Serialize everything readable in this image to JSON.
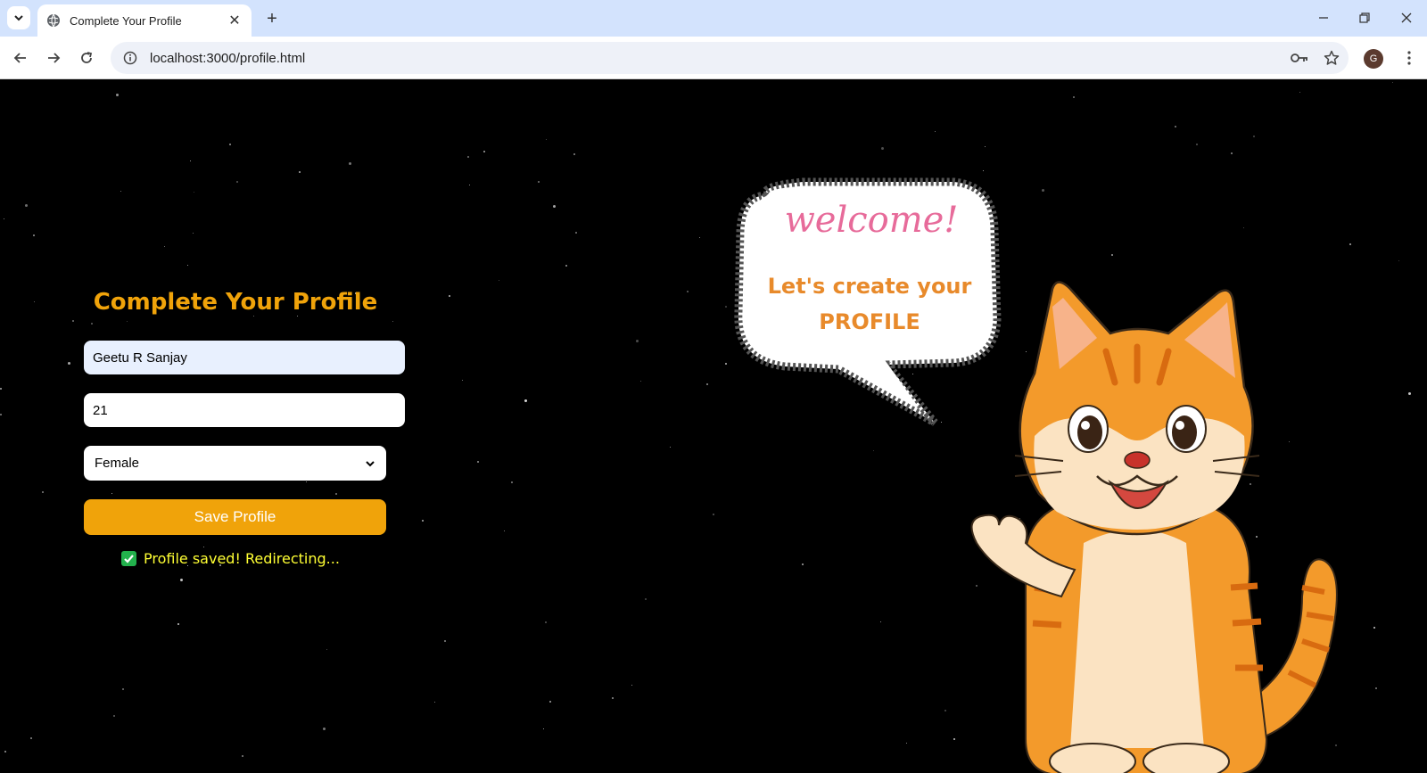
{
  "browser": {
    "tab_title": "Complete Your Profile",
    "url": "localhost:3000/profile.html",
    "profile_initial": "G"
  },
  "form": {
    "title": "Complete Your Profile",
    "name_value": "Geetu R Sanjay",
    "age_value": "21",
    "gender_value": "Female",
    "save_label": "Save Profile",
    "status_message": "Profile saved! Redirecting..."
  },
  "illustration": {
    "bubble_heading": "welcome!",
    "bubble_line_1": "Let's create your",
    "bubble_line_2": "PROFILE"
  },
  "colors": {
    "accent": "#f0a30a",
    "status_text": "#ffff33",
    "background": "#000000"
  }
}
